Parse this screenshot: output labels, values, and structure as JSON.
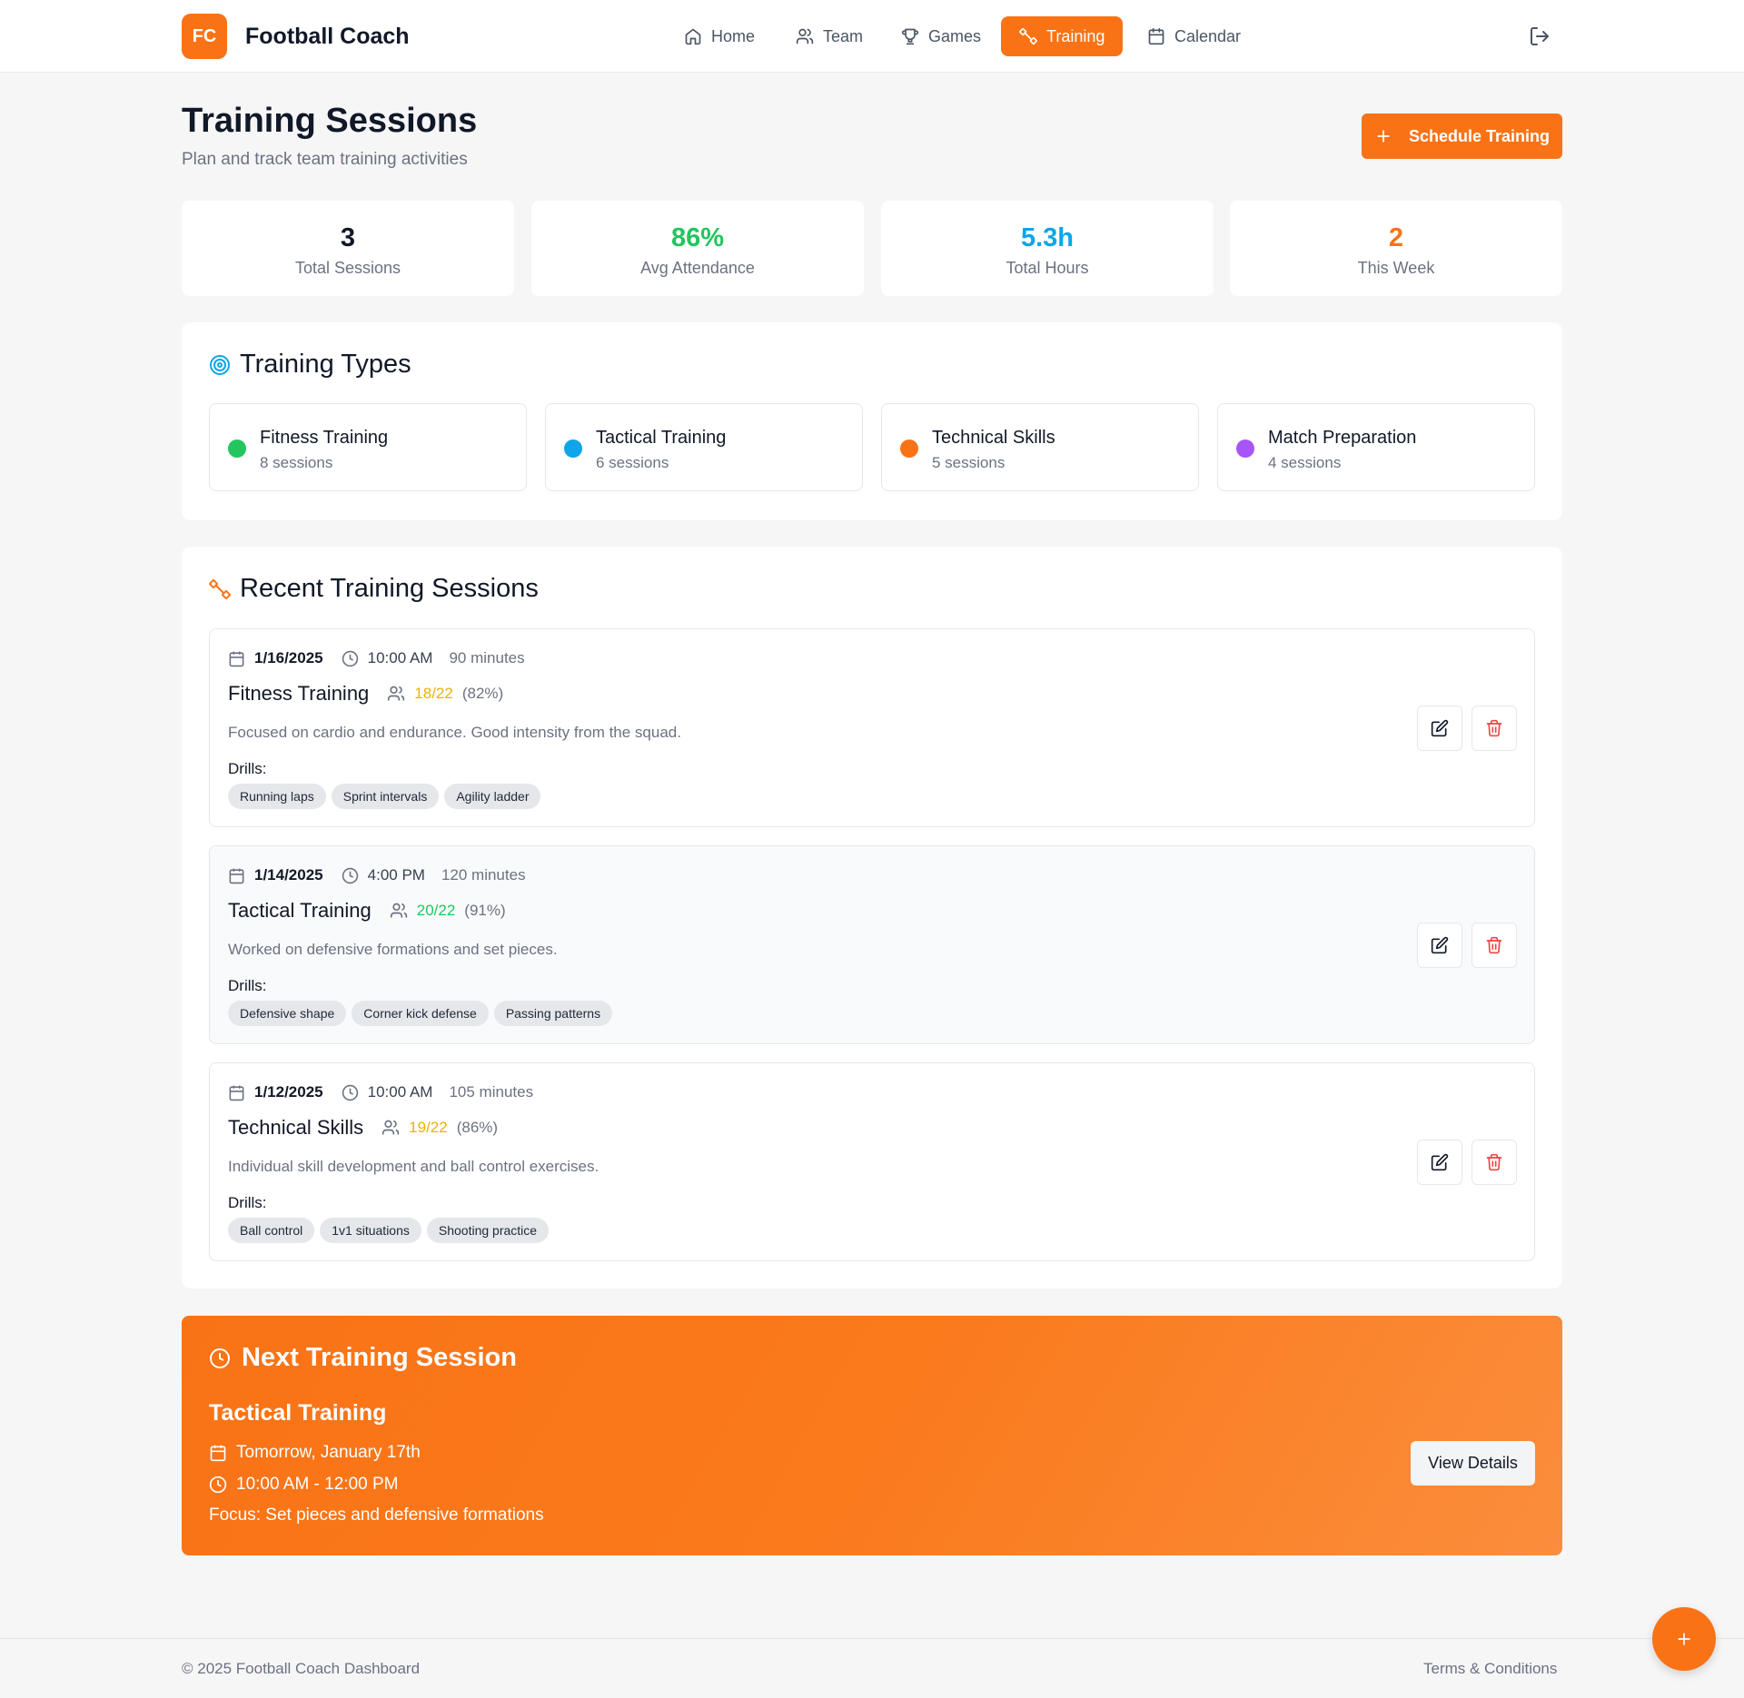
{
  "app": {
    "logo": "FC",
    "name": "Football Coach"
  },
  "nav": [
    {
      "label": "Home",
      "icon": "home-icon"
    },
    {
      "label": "Team",
      "icon": "users-icon"
    },
    {
      "label": "Games",
      "icon": "trophy-icon"
    },
    {
      "label": "Training",
      "icon": "dumbbell-icon",
      "active": true
    },
    {
      "label": "Calendar",
      "icon": "calendar-icon"
    }
  ],
  "page": {
    "title": "Training Sessions",
    "subtitle": "Plan and track team training activities",
    "schedule_label": "Schedule Training"
  },
  "stats": [
    {
      "value": "3",
      "label": "Total Sessions",
      "color": "#111827"
    },
    {
      "value": "86%",
      "label": "Avg Attendance",
      "color": "#22c55e"
    },
    {
      "value": "5.3h",
      "label": "Total Hours",
      "color": "#0ea5e9"
    },
    {
      "value": "2",
      "label": "This Week",
      "color": "#f97316"
    }
  ],
  "types": {
    "heading": "Training Types",
    "items": [
      {
        "name": "Fitness Training",
        "count": "8 sessions",
        "color": "#22c55e"
      },
      {
        "name": "Tactical Training",
        "count": "6 sessions",
        "color": "#0ea5e9"
      },
      {
        "name": "Technical Skills",
        "count": "5 sessions",
        "color": "#f97316"
      },
      {
        "name": "Match Preparation",
        "count": "4 sessions",
        "color": "#a855f7"
      }
    ]
  },
  "recent": {
    "heading": "Recent Training Sessions",
    "drills_label": "Drills:",
    "sessions": [
      {
        "date": "1/16/2025",
        "time": "10:00 AM",
        "duration": "90 minutes",
        "title": "Fitness Training",
        "attendance": "18/22",
        "attendance_color": "#eab308",
        "pct": "(82%)",
        "notes": "Focused on cardio and endurance. Good intensity from the squad.",
        "drills": [
          "Running laps",
          "Sprint intervals",
          "Agility ladder"
        ]
      },
      {
        "date": "1/14/2025",
        "time": "4:00 PM",
        "duration": "120 minutes",
        "title": "Tactical Training",
        "attendance": "20/22",
        "attendance_color": "#22c55e",
        "pct": "(91%)",
        "notes": "Worked on defensive formations and set pieces.",
        "drills": [
          "Defensive shape",
          "Corner kick defense",
          "Passing patterns"
        ]
      },
      {
        "date": "1/12/2025",
        "time": "10:00 AM",
        "duration": "105 minutes",
        "title": "Technical Skills",
        "attendance": "19/22",
        "attendance_color": "#eab308",
        "pct": "(86%)",
        "notes": "Individual skill development and ball control exercises.",
        "drills": [
          "Ball control",
          "1v1 situations",
          "Shooting practice"
        ]
      }
    ]
  },
  "next": {
    "heading": "Next Training Session",
    "title": "Tactical Training",
    "date": "Tomorrow, January 17th",
    "time": "10:00 AM - 12:00 PM",
    "focus": "Focus: Set pieces and defensive formations",
    "button": "View Details"
  },
  "footer": {
    "copyright": "© 2025 Football Coach Dashboard",
    "terms": "Terms & Conditions"
  }
}
